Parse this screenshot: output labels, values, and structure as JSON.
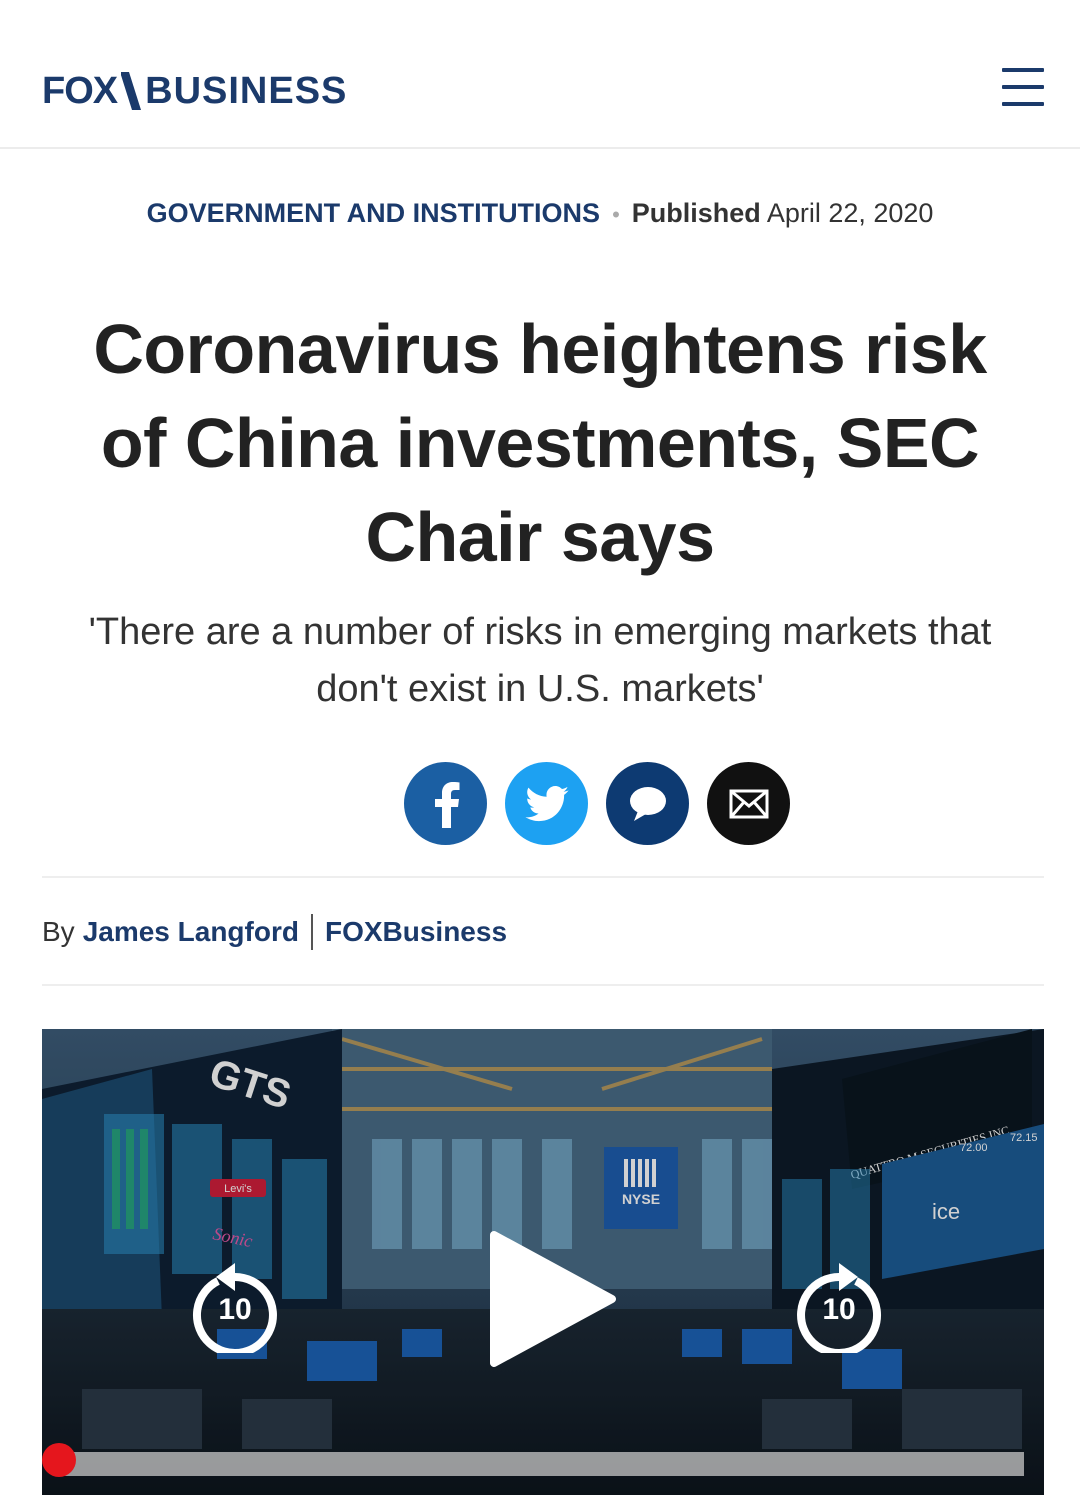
{
  "header": {
    "logo_fox": "FOX",
    "logo_business": "BUSINESS",
    "menu_icon": "hamburger-menu-icon"
  },
  "article": {
    "category": "GOVERNMENT AND INSTITUTIONS",
    "published_label": "Published",
    "published_date": "April 22, 2020",
    "headline": "Coronavirus heightens risk of China investments, SEC Chair says",
    "subhead": "'There are a number of risks in emerging markets that don't exist in U.S. markets'",
    "byline_prefix": "By",
    "author": "James Langford",
    "outlet": "FOXBusiness"
  },
  "share": {
    "buttons": [
      "facebook-icon",
      "twitter-icon",
      "comment-icon",
      "email-icon"
    ]
  },
  "video": {
    "skip_back_label": "10",
    "skip_forward_label": "10",
    "progress": 0.0,
    "scene_signs": {
      "gts": "GTS",
      "nyse": "NYSE",
      "quattro": "QUATTRO M SECURITIES INC.",
      "ice": "ice",
      "levis": "Levi's",
      "sonic": "Sonic",
      "price_1": "72.15",
      "price_2": "72.00"
    }
  },
  "colors": {
    "brand_navy": "#1b3a6b",
    "accent_red": "#c8102e",
    "facebook": "#1b5fa3",
    "twitter": "#1da1f2",
    "comment": "#0d3a72",
    "email": "#111111",
    "progress_knob": "#e5161d"
  }
}
